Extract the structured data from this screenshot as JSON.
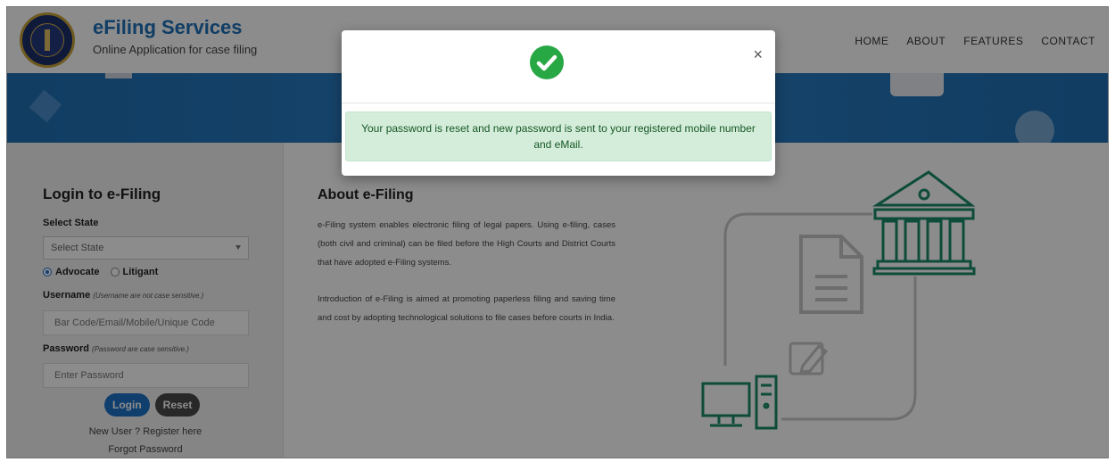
{
  "header": {
    "brand_title": "eFiling Services",
    "brand_subtitle": "Online Application for case filing",
    "nav": [
      "HOME",
      "ABOUT",
      "FEATURES",
      "CONTACT"
    ]
  },
  "login": {
    "title": "Login to e-Filing",
    "state_label": "Select State",
    "state_value": "Select State",
    "radio_advocate": "Advocate",
    "radio_litigant": "Litigant",
    "username_label": "Username",
    "username_hint": "(Username are not case sensitive.)",
    "username_placeholder": "Bar Code/Email/Mobile/Unique Code",
    "password_label": "Password",
    "password_hint": "(Password are case sensitive.)",
    "password_placeholder": "Enter Password",
    "login_button": "Login",
    "reset_button": "Reset",
    "register_link": "New User ? Register here",
    "forgot_link": "Forgot Password"
  },
  "about": {
    "title": "About e-Filing",
    "para1": "e-Filing system enables electronic filing of legal papers. Using e-filing, cases (both civil and criminal) can be filed before the High Courts and District Courts that have adopted e-Filing systems.",
    "para2": "Introduction of e-Filing is aimed at promoting paperless filing and saving time and cost by adopting technological solutions to file cases before courts in India."
  },
  "modal": {
    "close_label": "×",
    "message": "Your password is reset and new password is sent to your registered mobile number and eMail."
  },
  "colors": {
    "brand": "#1e6fb8",
    "success_icon": "#28a745",
    "alert_bg": "#d4edda",
    "alert_text": "#155724",
    "illustration": "#1a8a6a"
  },
  "icons": [
    "emblem-logo",
    "check-circle-icon",
    "close-icon",
    "court-building-icon",
    "document-icon",
    "edit-icon",
    "computer-icon",
    "dropdown-arrow-icon"
  ]
}
